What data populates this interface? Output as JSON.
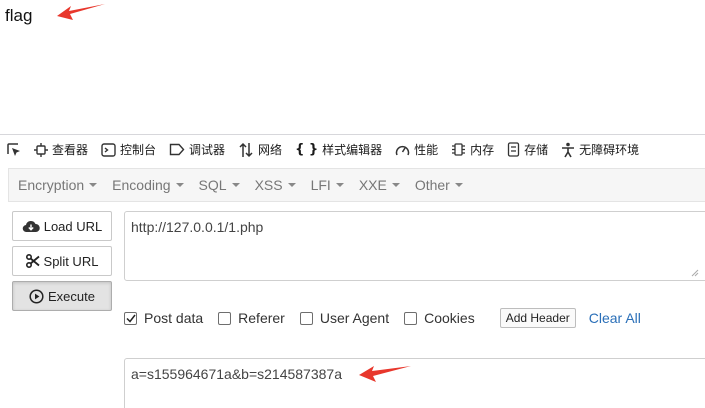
{
  "page": {
    "text": "flag"
  },
  "devtools": {
    "tabs": [
      {
        "label": "查看器",
        "icon": "inspector-icon"
      },
      {
        "label": "控制台",
        "icon": "console-icon"
      },
      {
        "label": "调试器",
        "icon": "debugger-icon"
      },
      {
        "label": "网络",
        "icon": "network-icon"
      },
      {
        "label": "样式编辑器",
        "icon": "style-editor-icon"
      },
      {
        "label": "性能",
        "icon": "performance-icon"
      },
      {
        "label": "内存",
        "icon": "memory-icon"
      },
      {
        "label": "存储",
        "icon": "storage-icon"
      },
      {
        "label": "无障碍环境",
        "icon": "accessibility-icon"
      }
    ]
  },
  "hackbar": {
    "menu": [
      "Encryption",
      "Encoding",
      "SQL",
      "XSS",
      "LFI",
      "XXE",
      "Other"
    ],
    "buttons": {
      "load_url": "Load URL",
      "split_url": "Split URL",
      "execute": "Execute"
    },
    "url_value": "http://127.0.0.1/1.php",
    "options": [
      {
        "label": "Post data",
        "checked": true
      },
      {
        "label": "Referer",
        "checked": false
      },
      {
        "label": "User Agent",
        "checked": false
      },
      {
        "label": "Cookies",
        "checked": false
      }
    ],
    "add_header": "Add Header",
    "clear_all": "Clear All",
    "post_value": "a=s155964671a&b=s214587387a"
  },
  "colors": {
    "annotation_arrow": "#e8372c",
    "link": "#2a6fb8"
  }
}
